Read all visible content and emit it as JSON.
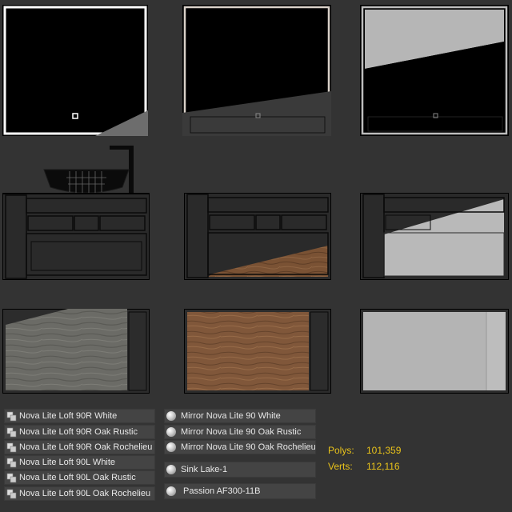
{
  "layers": [
    "Nova Lite Loft 90R White",
    "Nova Lite Loft 90R Oak Rustic",
    "Nova Lite Loft 90R Oak Rochelieu",
    "Nova Lite Loft 90L White",
    "Nova Lite Loft 90L Oak Rustic",
    "Nova Lite Loft 90L Oak Rochelieu"
  ],
  "objects": [
    "Mirror Nova Lite 90 White",
    "Mirror Nova Lite 90 Oak Rustic",
    "Mirror Nova Lite 90 Oak Rochelieu",
    "Sink Lake-1",
    "Passion AF300-11B"
  ],
  "stats": {
    "polys_label": "Polys:",
    "polys_value": "101,359",
    "verts_label": "Verts:",
    "verts_value": "112,116"
  },
  "colors": {
    "background": "#333333",
    "stats_text": "#e8c21a",
    "oak_rustic": "#7a5234",
    "oak_rochelieu": "#6b6b66",
    "white_finish": "#b9b9b9"
  }
}
